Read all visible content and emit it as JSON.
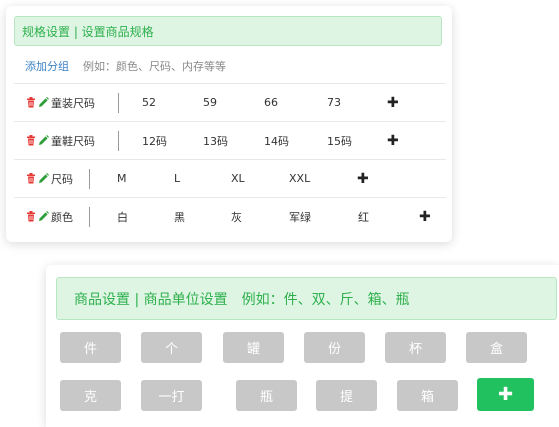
{
  "spec": {
    "alert": "规格设置 | 设置商品规格",
    "add_group": "添加分组",
    "hint": "例如：颜色、尺码、内存等等",
    "rows": [
      {
        "name": "童装尺码",
        "values": [
          "52",
          "59",
          "66",
          "73"
        ]
      },
      {
        "name": "童鞋尺码",
        "values": [
          "12码",
          "13码",
          "14码",
          "15码"
        ]
      },
      {
        "name": "尺码",
        "values": [
          "M",
          "L",
          "XL",
          "XXL"
        ]
      },
      {
        "name": "颜色",
        "values": [
          "白",
          "黑",
          "灰",
          "军绿",
          "红"
        ]
      }
    ],
    "add_value_glyph": "✚"
  },
  "unit": {
    "alert": "商品设置 | 商品单位设置　例如：件、双、斤、箱、瓶",
    "buttons": [
      "件",
      "个",
      "罐",
      "份",
      "杯",
      "盒",
      "克",
      "一打",
      "瓶",
      "提",
      "箱"
    ],
    "add_glyph": "✚"
  },
  "colors": {
    "accent_green": "#22c160",
    "alert_text": "#2db04c",
    "link": "#3b82c4",
    "danger": "#e53935",
    "edit": "#2e9e3a"
  },
  "icons": {
    "delete": "trash-icon",
    "edit": "pencil-icon",
    "add": "plus-icon"
  }
}
